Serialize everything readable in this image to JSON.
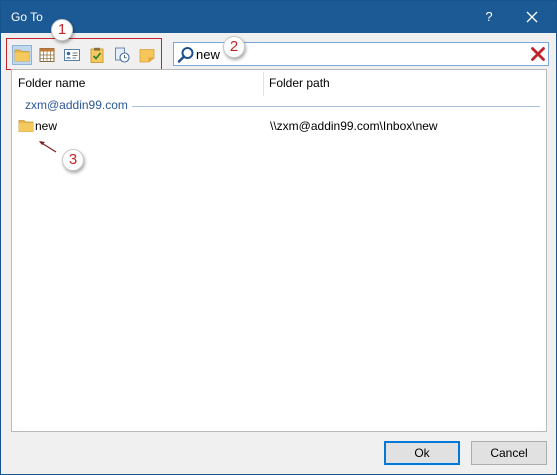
{
  "window": {
    "title": "Go To",
    "help_glyph": "?",
    "colors": {
      "titlebar": "#1c5a96",
      "callout_text": "#c0242b",
      "clear_icon": "#c0242b",
      "group_text": "#2b579a"
    }
  },
  "toolbar": {
    "buttons": [
      {
        "name": "folder-view-button",
        "icon": "folder-icon",
        "active": true
      },
      {
        "name": "calendar-view-button",
        "icon": "calendar-icon",
        "active": false
      },
      {
        "name": "contacts-view-button",
        "icon": "contact-card-icon",
        "active": false
      },
      {
        "name": "tasks-view-button",
        "icon": "task-clipboard-icon",
        "active": false
      },
      {
        "name": "journal-view-button",
        "icon": "journal-clock-icon",
        "active": false
      },
      {
        "name": "notes-view-button",
        "icon": "sticky-note-icon",
        "active": false
      }
    ]
  },
  "search": {
    "value": "new",
    "placeholder": ""
  },
  "callouts": [
    "1",
    "2",
    "3"
  ],
  "list": {
    "columns": [
      "Folder name",
      "Folder path"
    ],
    "group": "zxm@addin99.com",
    "rows": [
      {
        "name": "new",
        "path": "\\\\zxm@addin99.com\\Inbox\\new",
        "icon": "folder-icon"
      }
    ]
  },
  "footer": {
    "ok_label": "Ok",
    "cancel_label": "Cancel"
  }
}
